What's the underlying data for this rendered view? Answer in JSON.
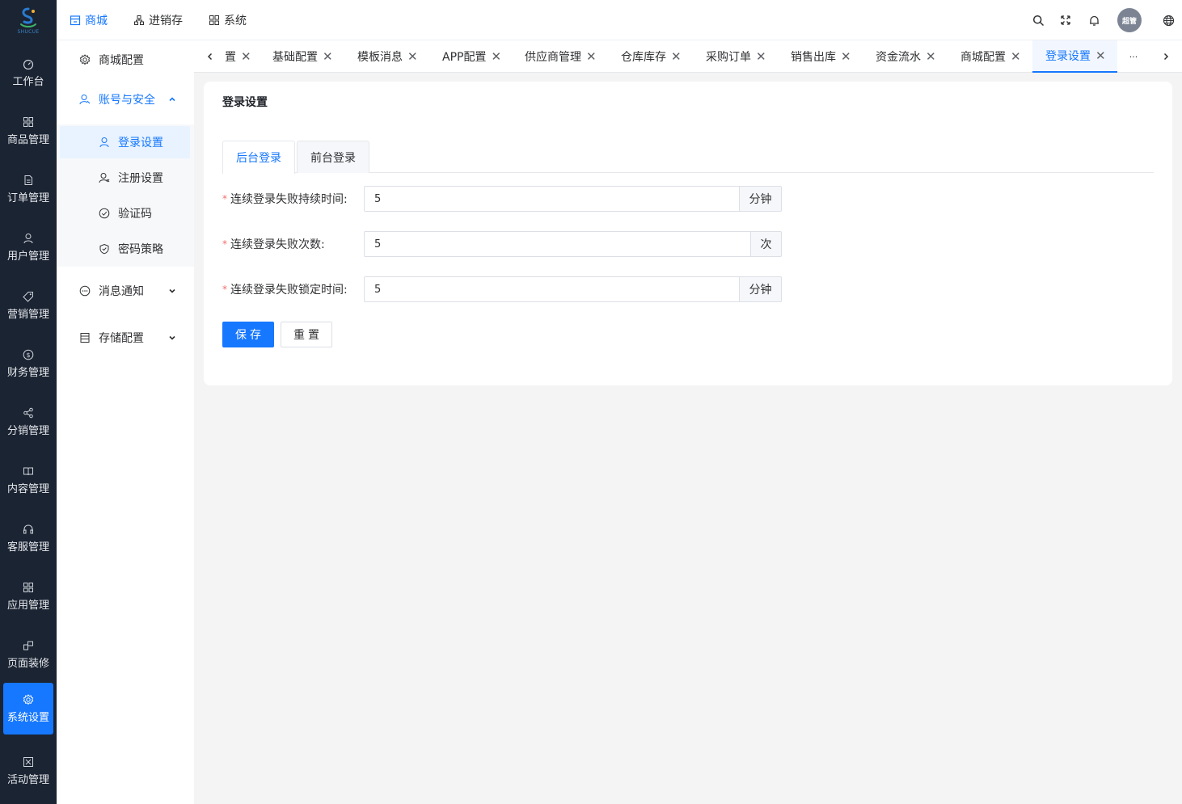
{
  "logo": {
    "text": "SHUCUE"
  },
  "sidebar": {
    "items": [
      {
        "label": "工作台",
        "icon": "dashboard-icon"
      },
      {
        "label": "商品管理",
        "icon": "grid-icon"
      },
      {
        "label": "订单管理",
        "icon": "document-icon"
      },
      {
        "label": "用户管理",
        "icon": "user-icon"
      },
      {
        "label": "营销管理",
        "icon": "tag-icon"
      },
      {
        "label": "财务管理",
        "icon": "dollar-icon"
      },
      {
        "label": "分销管理",
        "icon": "share-icon"
      },
      {
        "label": "内容管理",
        "icon": "book-icon"
      },
      {
        "label": "客服管理",
        "icon": "headset-icon"
      },
      {
        "label": "应用管理",
        "icon": "apps-icon"
      },
      {
        "label": "页面装修",
        "icon": "layout-icon"
      },
      {
        "label": "系统设置",
        "icon": "gear-icon",
        "active": true
      },
      {
        "label": "活动管理",
        "icon": "activity-icon"
      }
    ]
  },
  "header": {
    "nav": [
      {
        "label": "商城",
        "icon": "store-icon",
        "active": true
      },
      {
        "label": "进销存",
        "icon": "hierarchy-icon"
      },
      {
        "label": "系统",
        "icon": "apps-icon"
      }
    ],
    "avatar_text": "超管",
    "accent": "#1677ff"
  },
  "submenu": {
    "items": [
      {
        "label": "商城配置",
        "icon": "gear-icon"
      },
      {
        "label": "账号与安全",
        "icon": "user-icon",
        "open": true
      },
      {
        "label": "消息通知",
        "icon": "chat-icon"
      },
      {
        "label": "存储配置",
        "icon": "storage-icon"
      }
    ],
    "children": [
      {
        "label": "登录设置",
        "icon": "user-icon",
        "active": true
      },
      {
        "label": "注册设置",
        "icon": "user-add-icon"
      },
      {
        "label": "验证码",
        "icon": "check-circle-icon"
      },
      {
        "label": "密码策略",
        "icon": "shield-icon"
      }
    ]
  },
  "tabs": {
    "items": [
      {
        "label": "置"
      },
      {
        "label": "基础配置"
      },
      {
        "label": "模板消息"
      },
      {
        "label": "APP配置"
      },
      {
        "label": "供应商管理"
      },
      {
        "label": "仓库库存"
      },
      {
        "label": "采购订单"
      },
      {
        "label": "销售出库"
      },
      {
        "label": "资金流水"
      },
      {
        "label": "商城配置"
      },
      {
        "label": "登录设置",
        "active": true
      }
    ],
    "more": "···",
    "close_symbol": "✕"
  },
  "card": {
    "title": "登录设置",
    "form_tabs": [
      {
        "label": "后台登录",
        "active": true
      },
      {
        "label": "前台登录"
      }
    ],
    "fields": [
      {
        "label": "连续登录失败持续时间:",
        "value": "5",
        "unit": "分钟",
        "required": "*"
      },
      {
        "label": "连续登录失败次数:",
        "value": "5",
        "unit": "次",
        "required": "*"
      },
      {
        "label": "连续登录失败锁定时间:",
        "value": "5",
        "unit": "分钟",
        "required": "*"
      }
    ],
    "buttons": {
      "save": "保存",
      "reset": "重置"
    }
  }
}
